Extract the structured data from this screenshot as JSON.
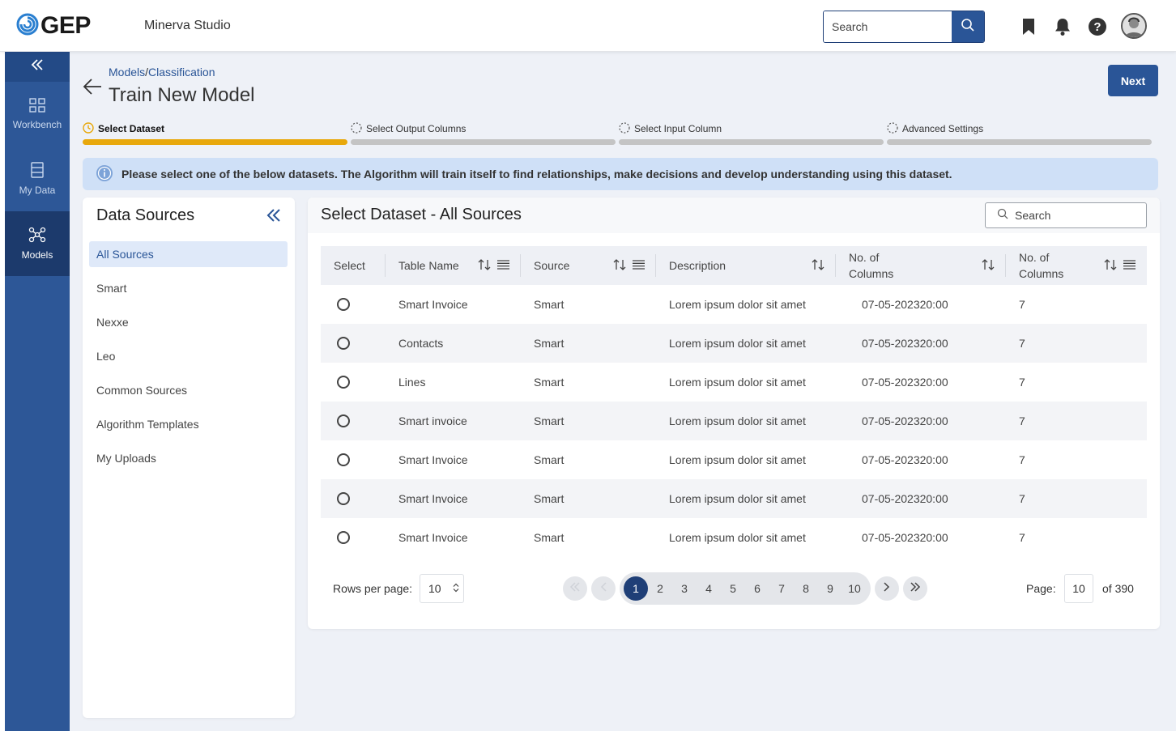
{
  "header": {
    "logo_text": "GEP",
    "app_title": "Minerva Studio",
    "search_placeholder": "Search"
  },
  "leftnav": {
    "items": [
      {
        "label": "Workbench",
        "icon": "workbench-icon"
      },
      {
        "label": "My Data",
        "icon": "my-data-icon"
      },
      {
        "label": "Models",
        "icon": "models-icon"
      }
    ]
  },
  "page": {
    "breadcrumb": {
      "parent": "Models",
      "separator": "/",
      "current": "Classification"
    },
    "title": "Train New Model",
    "next_label": "Next"
  },
  "stepper": {
    "steps": [
      {
        "label": "Select Dataset",
        "state": "active"
      },
      {
        "label": "Select Output Columns",
        "state": "pending"
      },
      {
        "label": "Select Input Column",
        "state": "pending"
      },
      {
        "label": "Advanced Settings",
        "state": "pending"
      }
    ]
  },
  "info": {
    "text": "Please select one of the below datasets. The Algorithm will train itself to find relationships, make decisions and develop understanding using this dataset."
  },
  "data_sources": {
    "title": "Data Sources",
    "items": [
      "All Sources",
      "Smart",
      "Nexxe",
      "Leo",
      "Common Sources",
      "Algorithm Templates",
      "My Uploads"
    ],
    "selected": "All Sources"
  },
  "dataset": {
    "title": "Select Dataset - All Sources",
    "search_placeholder": "Search",
    "columns": {
      "select": "Select",
      "table_name": "Table Name",
      "source": "Source",
      "description": "Description",
      "col4_line1": "No. of",
      "col4_line2": "Columns",
      "col5_line1": "No. of",
      "col5_line2": "Columns"
    },
    "rows": [
      {
        "table_name": "Smart Invoice",
        "source": "Smart",
        "description": "Lorem ipsum dolor sit amet",
        "date": "07-05-202320:00",
        "count": "7"
      },
      {
        "table_name": "Contacts",
        "source": "Smart",
        "description": "Lorem ipsum dolor sit amet",
        "date": "07-05-202320:00",
        "count": "7"
      },
      {
        "table_name": "Lines",
        "source": "Smart",
        "description": "Lorem ipsum dolor sit amet",
        "date": "07-05-202320:00",
        "count": "7"
      },
      {
        "table_name": "Smart invoice",
        "source": "Smart",
        "description": "Lorem ipsum dolor sit amet",
        "date": "07-05-202320:00",
        "count": "7"
      },
      {
        "table_name": "Smart Invoice",
        "source": "Smart",
        "description": "Lorem ipsum dolor sit amet",
        "date": "07-05-202320:00",
        "count": "7"
      },
      {
        "table_name": "Smart Invoice",
        "source": "Smart",
        "description": "Lorem ipsum dolor sit amet",
        "date": "07-05-202320:00",
        "count": "7"
      },
      {
        "table_name": "Smart Invoice",
        "source": "Smart",
        "description": "Lorem ipsum dolor sit amet",
        "date": "07-05-202320:00",
        "count": "7"
      }
    ]
  },
  "pagination": {
    "rows_per_page_label": "Rows per page:",
    "rows_per_page": "10",
    "pages": [
      "1",
      "2",
      "3",
      "4",
      "5",
      "6",
      "7",
      "8",
      "9",
      "10"
    ],
    "current_page": "1",
    "page_label": "Page:",
    "page_value": "10",
    "page_total": "of 390"
  },
  "colors": {
    "brand": "#2a5597",
    "nav": "#2d5797",
    "active_step": "#e8a80c",
    "info_bg": "#cfe0f7"
  }
}
